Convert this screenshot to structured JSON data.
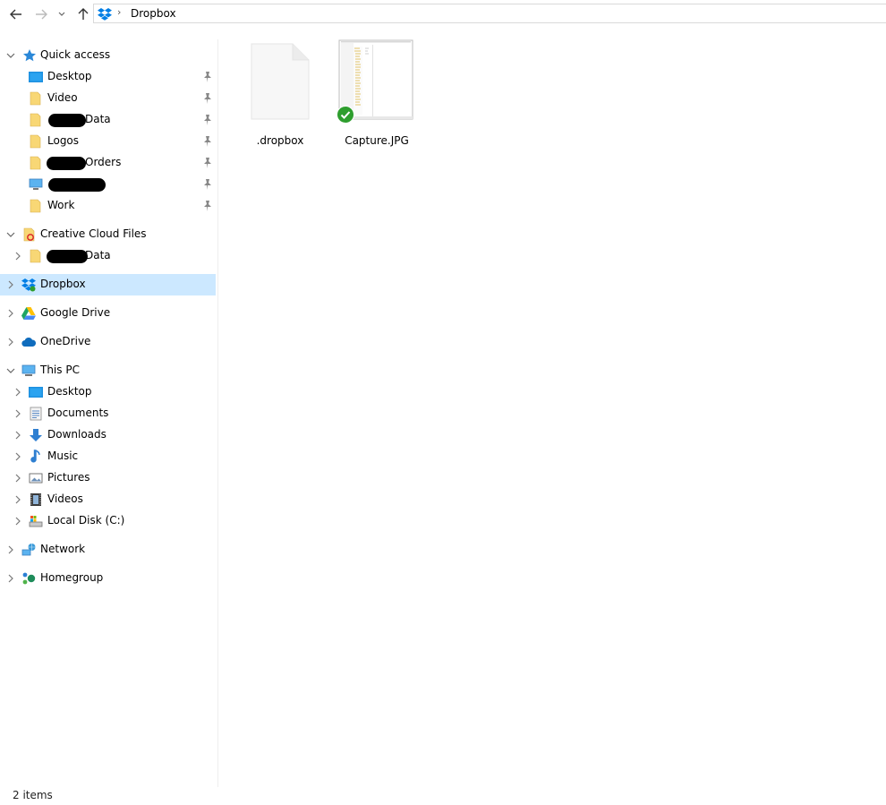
{
  "toolbar": {
    "breadcrumb": "Dropbox"
  },
  "nav": {
    "quick_access": "Quick access",
    "qa_items": [
      {
        "label": "Desktop"
      },
      {
        "label": "Video"
      },
      {
        "label": "Data"
      },
      {
        "label": "Logos"
      },
      {
        "label": "Orders"
      },
      {
        "label": ""
      },
      {
        "label": "Work"
      }
    ],
    "creative_cloud": "Creative Cloud Files",
    "cc_item": "Data",
    "dropbox": "Dropbox",
    "google_drive": "Google Drive",
    "onedrive": "OneDrive",
    "this_pc": "This PC",
    "pc_items": [
      {
        "label": "Desktop"
      },
      {
        "label": "Documents"
      },
      {
        "label": "Downloads"
      },
      {
        "label": "Music"
      },
      {
        "label": "Pictures"
      },
      {
        "label": "Videos"
      },
      {
        "label": "Local Disk (C:)"
      }
    ],
    "network": "Network",
    "homegroup": "Homegroup"
  },
  "files": [
    {
      "name": ".dropbox",
      "icon": "blank-file-icon"
    },
    {
      "name": "Capture.JPG",
      "icon": "image-thumbnail",
      "sync_status": "synced"
    }
  ],
  "status_bar": {
    "item_count": "2 items"
  },
  "colors": {
    "selection": "#cce8ff",
    "folder": "#f8d775",
    "dropbox_blue": "#007ee5",
    "sync_green": "#2e9e2e"
  }
}
